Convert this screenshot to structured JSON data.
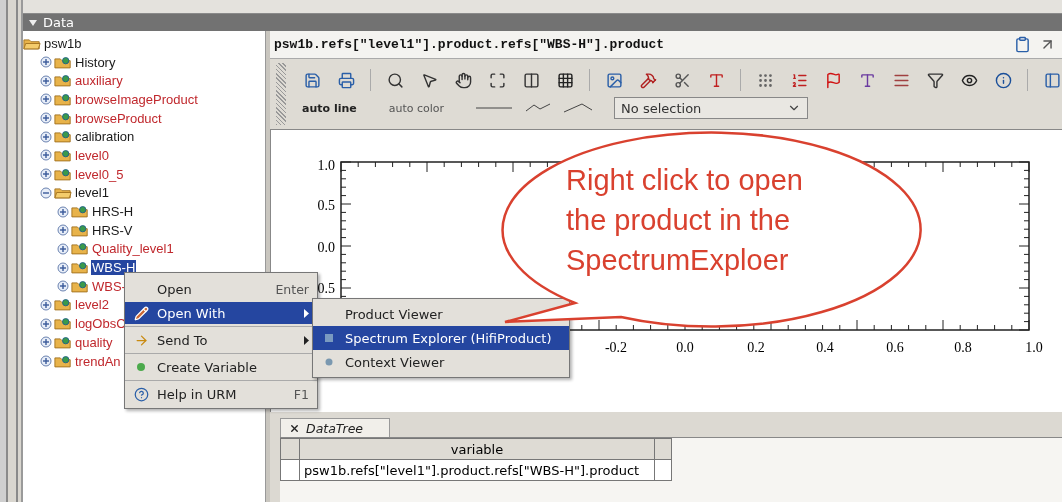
{
  "panel": {
    "title": "Data",
    "expanded": true
  },
  "tree": [
    {
      "label": "psw1b",
      "expanded": true,
      "selected": false,
      "color": "#1a1a1a",
      "children": [
        {
          "label": "History",
          "expanded": false,
          "selected": false,
          "color": "#1a1a1a"
        },
        {
          "label": "auxiliary",
          "expanded": false,
          "selected": false,
          "color": "#c0282d"
        },
        {
          "label": "browseImageProduct",
          "expanded": false,
          "selected": false,
          "color": "#c0282d"
        },
        {
          "label": "browseProduct",
          "expanded": false,
          "selected": false,
          "color": "#c0282d"
        },
        {
          "label": "calibration",
          "expanded": false,
          "selected": false,
          "color": "#1a1a1a"
        },
        {
          "label": "level0",
          "expanded": false,
          "selected": false,
          "color": "#c0282d"
        },
        {
          "label": "level0_5",
          "expanded": false,
          "selected": false,
          "color": "#c0282d"
        },
        {
          "label": "level1",
          "expanded": true,
          "selected": false,
          "color": "#1a1a1a",
          "children": [
            {
              "label": "HRS-H",
              "expanded": false,
              "selected": false,
              "color": "#1a1a1a"
            },
            {
              "label": "HRS-V",
              "expanded": false,
              "selected": false,
              "color": "#1a1a1a"
            },
            {
              "label": "Quality_level1",
              "expanded": false,
              "selected": false,
              "color": "#c0282d"
            },
            {
              "label": "WBS-H",
              "expanded": false,
              "selected": true
            },
            {
              "label": "WBS-",
              "expanded": false,
              "selected": false,
              "color": "#c0282d"
            }
          ]
        },
        {
          "label": "level2",
          "expanded": false,
          "selected": false,
          "color": "#c0282d"
        },
        {
          "label": "logObsC",
          "expanded": false,
          "selected": false,
          "color": "#c0282d"
        },
        {
          "label": "quality",
          "expanded": false,
          "selected": false,
          "color": "#c0282d"
        },
        {
          "label": "trendAn",
          "expanded": false,
          "selected": false,
          "color": "#c0282d"
        }
      ]
    }
  ],
  "viewer": {
    "path": "psw1b.refs[\"level1\"].product.refs[\"WBS-H\"].product",
    "toolbar": {
      "line_mode": "auto line",
      "color_mode": "auto color",
      "selection": "No selection"
    },
    "plot": {
      "y_tick_labels": [
        "1.0",
        "0.5",
        "0.0",
        "0.5"
      ],
      "x_tick_labels": [
        "-0.2",
        "0.0",
        "0.2",
        "0.4",
        "0.6",
        "0.8",
        "1.0"
      ]
    }
  },
  "bottom": {
    "tabs": [
      {
        "label": "DataTree",
        "selected": true
      }
    ],
    "table": {
      "columns": [
        "variable"
      ],
      "rows": [
        [
          "psw1b.refs[\"level1\"].product.refs[\"WBS-H\"].product"
        ]
      ]
    }
  },
  "context_menu": {
    "items": [
      {
        "label": "Open",
        "shortcut": "Enter",
        "submenu": false,
        "selected": false
      },
      {
        "label": "Open With",
        "submenu": true,
        "selected": true
      },
      {
        "label": "Send To",
        "submenu": true,
        "selected": false
      },
      {
        "label": "Create Variable",
        "submenu": false,
        "selected": false
      },
      {
        "label": "Help in URM",
        "shortcut": "F1",
        "submenu": false,
        "selected": false
      }
    ]
  },
  "submenu": {
    "items": [
      {
        "label": "Product Viewer",
        "selected": false
      },
      {
        "label": "Spectrum Explorer (HifiProduct)",
        "selected": true
      },
      {
        "label": "Context Viewer",
        "selected": false
      }
    ]
  },
  "callout": {
    "lines": [
      "Right click to open",
      "the product in the",
      "SpectrumExploer"
    ]
  }
}
